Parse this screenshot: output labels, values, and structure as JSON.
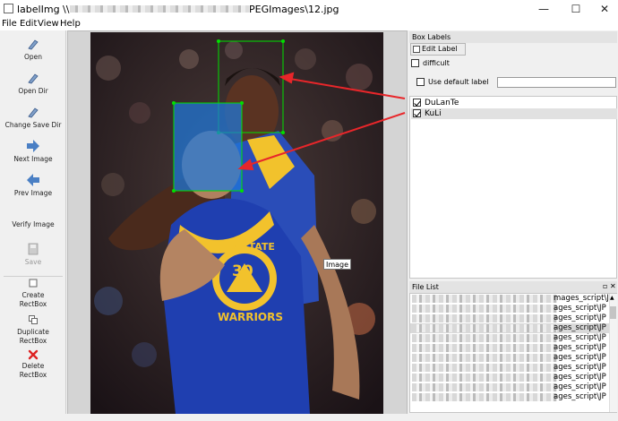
{
  "window": {
    "title_prefix": "labelImg \\\\",
    "title_suffix": "PEGImages\\12.jpg",
    "minimize_glyph": "—",
    "maximize_glyph": "☐",
    "close_glyph": "✕"
  },
  "menu": {
    "file": "File",
    "edit": "Edit",
    "view": "View",
    "help": "Help"
  },
  "toolbar": {
    "open": "Open",
    "open_dir": "Open Dir",
    "change_save_dir": "Change Save Dir",
    "next_image": "Next Image",
    "prev_image": "Prev Image",
    "verify_image": "Verify Image",
    "save": "Save",
    "create_rectbox_1": "Create",
    "create_rectbox_2": "RectBox",
    "duplicate_rectbox_1": "Duplicate",
    "duplicate_rectbox_2": "RectBox",
    "delete_rectbox_1": "Delete",
    "delete_rectbox_2": "RectBox"
  },
  "canvas": {
    "tooltip": "Image",
    "jersey_team": "DEN STATE",
    "jersey_number": "30",
    "jersey_wordmark": "WARRIORS"
  },
  "box_labels": {
    "title": "Box Labels",
    "edit_label_button": "Edit Label",
    "difficult": "difficult",
    "difficult_checked": false,
    "use_default_label": "Use default label",
    "use_default_checked": false,
    "default_label_value": "",
    "labels": [
      {
        "name": "DuLanTe",
        "checked": true
      },
      {
        "name": "KuLi",
        "checked": true
      }
    ]
  },
  "file_list": {
    "title": "File List",
    "rows": [
      "mages_script\\JP",
      "ages_script\\JP",
      "ages_script\\JP",
      "ages_script\\JP",
      "ages_script\\JP",
      "ages_script\\JP",
      "ages_script\\JP",
      "ages_script\\JP",
      "ages_script\\JP",
      "ages_script\\JP",
      "ages_script\\JP"
    ],
    "selected_row": 3
  },
  "colors": {
    "box_green": "#00e000",
    "box_blue_fill": "#1e78dc",
    "arrow_red": "#e8262a"
  }
}
